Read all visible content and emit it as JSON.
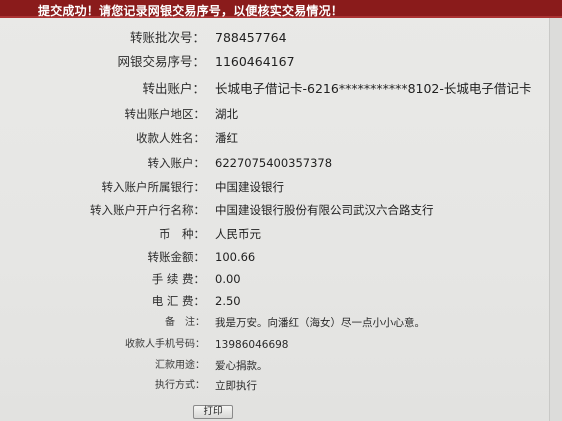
{
  "banner": {
    "message": "提交成功！请您记录网银交易序号，以便核实交易情况！"
  },
  "receipt": {
    "rows": [
      {
        "label": "转账批次号：",
        "value": "788457764"
      },
      {
        "label": "网银交易序号：",
        "value": "1160464167"
      },
      {
        "label": "转出账户：",
        "value": "长城电子借记卡-6216***********8102-长城电子借记卡"
      },
      {
        "label": "转出账户地区：",
        "value": "湖北"
      },
      {
        "label": "收款人姓名：",
        "value": "潘红"
      },
      {
        "label": "转入账户：",
        "value": "6227075400357378"
      },
      {
        "label": "转入账户所属银行：",
        "value": "中国建设银行"
      },
      {
        "label": "转入账户开户行名称：",
        "value": "中国建设银行股份有限公司武汉六合路支行"
      },
      {
        "label": "币　种：",
        "value": "人民币元"
      },
      {
        "label": "转账金额：",
        "value": "100.66"
      },
      {
        "label": "手 续 费：",
        "value": "0.00"
      },
      {
        "label": "电 汇 费：",
        "value": "2.50"
      },
      {
        "label": "备　注：",
        "value": "我是万安。向潘红（海女）尽一点小小心意。"
      },
      {
        "label": "收款人手机号码：",
        "value": "13986046698"
      },
      {
        "label": "汇款用途：",
        "value": "爱心捐款。"
      },
      {
        "label": "执行方式：",
        "value": "立即执行"
      }
    ]
  },
  "actions": {
    "print_label": "打印"
  }
}
